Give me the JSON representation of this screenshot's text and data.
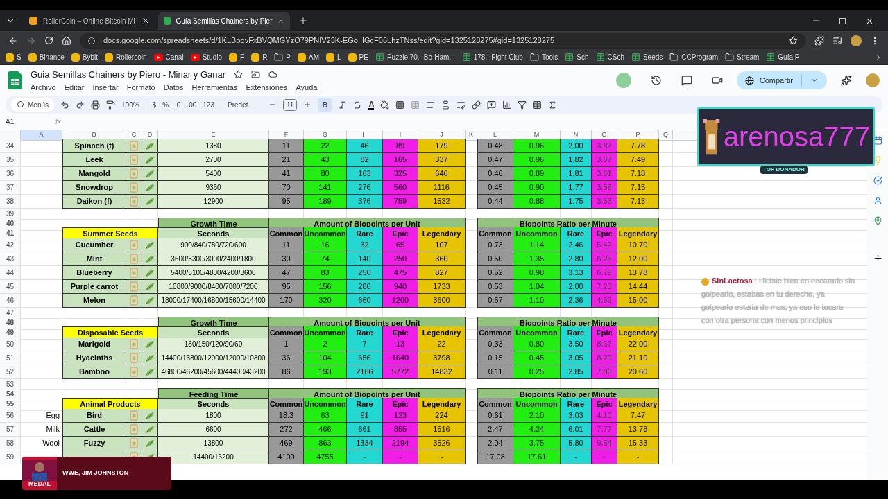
{
  "browser": {
    "tabs": [
      {
        "title": "RollerCoin – Online Bitcoin Mi",
        "selected": false
      },
      {
        "title": "Guía Semillas Chainers by Pier",
        "selected": true
      }
    ],
    "address": "docs.google.com/spreadsheets/d/1KLBogvFxBVQMGYzO79PNIV23K-EGo_IGcF06LhzTNss/edit?gid=1325128275#gid=1325128275",
    "bookmarks": [
      {
        "label": "S",
        "kind": "site"
      },
      {
        "label": "Binance",
        "kind": "site"
      },
      {
        "label": "Bybit",
        "kind": "site"
      },
      {
        "label": "Rollercoin",
        "kind": "site"
      },
      {
        "label": "Canal",
        "kind": "video"
      },
      {
        "label": "Studio",
        "kind": "video"
      },
      {
        "label": "F",
        "kind": "site"
      },
      {
        "label": "R",
        "kind": "site"
      },
      {
        "label": "P",
        "kind": "folder"
      },
      {
        "label": "AM",
        "kind": "site"
      },
      {
        "label": "L",
        "kind": "site"
      },
      {
        "label": "PE",
        "kind": "site"
      },
      {
        "label": "Puzzle 70.- Bo-Ham...",
        "kind": "sheet"
      },
      {
        "label": "178.- Fight Club",
        "kind": "sheet"
      },
      {
        "label": "Tools",
        "kind": "folder"
      },
      {
        "label": "Sch",
        "kind": "sheet"
      },
      {
        "label": "CSch",
        "kind": "sheet"
      },
      {
        "label": "Seeds",
        "kind": "sheet"
      },
      {
        "label": "CCProgram",
        "kind": "folder"
      },
      {
        "label": "Stream",
        "kind": "folder"
      },
      {
        "label": "Guía P",
        "kind": "sheet"
      }
    ]
  },
  "doc": {
    "title": "Guia Semillas Chainers by Piero - Minar y Ganar",
    "menus": [
      "Archivo",
      "Editar",
      "Insertar",
      "Formato",
      "Datos",
      "Herramientas",
      "Extensiones",
      "Ayuda"
    ],
    "share": "Compartir"
  },
  "toolbar": {
    "menus": "Menús",
    "zoom": "100%",
    "currency": "$",
    "percent": "%",
    "dec_less": ".0",
    "dec_more": ".00",
    "number_format": "123",
    "font": "Predet...",
    "font_size": "11",
    "bold_label": "B",
    "text_color_label": "A",
    "bold": true
  },
  "formula_bar": {
    "cell": "A1",
    "fx": "fx"
  },
  "columns": [
    "A",
    "B",
    "C",
    "D",
    "E",
    "F",
    "G",
    "H",
    "I",
    "J",
    "K",
    "L",
    "M",
    "N",
    "O",
    "P",
    "Q"
  ],
  "rows": [
    {
      "kind": "data",
      "number": "34",
      "name": "Spinach (f)",
      "seconds": "1380",
      "amounts": [
        "11",
        "22",
        "46",
        "89",
        "179"
      ],
      "ratios": [
        "0.48",
        "0.96",
        "2.00",
        "3.87",
        "7.78"
      ]
    },
    {
      "kind": "data",
      "number": "35",
      "name": "Leek",
      "seconds": "2700",
      "amounts": [
        "21",
        "43",
        "82",
        "165",
        "337"
      ],
      "ratios": [
        "0.47",
        "0.96",
        "1.82",
        "3.67",
        "7.49"
      ]
    },
    {
      "kind": "data",
      "number": "36",
      "name": "Mangold",
      "seconds": "5400",
      "amounts": [
        "41",
        "80",
        "163",
        "325",
        "646"
      ],
      "ratios": [
        "0.46",
        "0.89",
        "1.81",
        "3.61",
        "7.18"
      ]
    },
    {
      "kind": "data",
      "number": "37",
      "name": "Snowdrop",
      "seconds": "9360",
      "amounts": [
        "70",
        "141",
        "276",
        "560",
        "1116"
      ],
      "ratios": [
        "0.45",
        "0.90",
        "1.77",
        "3.59",
        "7.15"
      ]
    },
    {
      "kind": "data",
      "number": "38",
      "name": "Daikon (f)",
      "seconds": "12900",
      "amounts": [
        "95",
        "189",
        "376",
        "759",
        "1532"
      ],
      "ratios": [
        "0.44",
        "0.88",
        "1.75",
        "3.53",
        "7.13"
      ]
    },
    {
      "kind": "blank",
      "number": "39"
    },
    {
      "kind": "group_header",
      "number": "40",
      "groups": [
        "Growth Time",
        "Amount of Biopoints per Unit",
        "Biopoints Ratio per Minute"
      ]
    },
    {
      "kind": "column_header",
      "number": "41",
      "title": "Summer Seeds",
      "seconds": "Seconds",
      "amounts": [
        "Common",
        "Uncommon",
        "Rare",
        "Epic",
        "Legendary"
      ],
      "ratios": [
        "Common",
        "Uncommon",
        "Rare",
        "Epic",
        "Legendary"
      ]
    },
    {
      "kind": "data",
      "number": "42",
      "name": "Cucumber",
      "seconds": "900/840/780/720/600",
      "amounts": [
        "11",
        "16",
        "32",
        "65",
        "107"
      ],
      "ratios": [
        "0.73",
        "1.14",
        "2.46",
        "5.42",
        "10.70"
      ]
    },
    {
      "kind": "data",
      "number": "43",
      "name": "Mint",
      "seconds": "3600/3300/3000/2400/1800",
      "amounts": [
        "30",
        "74",
        "140",
        "250",
        "360"
      ],
      "ratios": [
        "0.50",
        "1.35",
        "2.80",
        "6.25",
        "12.00"
      ]
    },
    {
      "kind": "data",
      "number": "44",
      "name": "Blueberry",
      "seconds": "5400/5100/4800/4200/3600",
      "amounts": [
        "47",
        "83",
        "250",
        "475",
        "827"
      ],
      "ratios": [
        "0.52",
        "0.98",
        "3.13",
        "6.79",
        "13.78"
      ]
    },
    {
      "kind": "data",
      "number": "45",
      "name": "Purple carrot",
      "seconds": "10800/9000/8400/7800/7200",
      "amounts": [
        "95",
        "156",
        "280",
        "940",
        "1733"
      ],
      "ratios": [
        "0.53",
        "1.04",
        "2.00",
        "7.23",
        "14.44"
      ]
    },
    {
      "kind": "data",
      "number": "46",
      "name": "Melon",
      "seconds": "18000/17400/16800/15600/14400",
      "amounts": [
        "170",
        "320",
        "660",
        "1200",
        "3600"
      ],
      "ratios": [
        "0.57",
        "1.10",
        "2.36",
        "4.62",
        "15.00"
      ]
    },
    {
      "kind": "blank",
      "number": "47"
    },
    {
      "kind": "group_header",
      "number": "48",
      "groups": [
        "Growth Time",
        "Amount of Biopoints per Unit",
        "Biopoints Ratio per Minute"
      ]
    },
    {
      "kind": "column_header",
      "number": "49",
      "title": "Disposable Seeds",
      "seconds": "Seconds",
      "amounts": [
        "Common",
        "Uncommon",
        "Rare",
        "Epic",
        "Legendary"
      ],
      "ratios": [
        "Common",
        "Uncommon",
        "Rare",
        "Epic",
        "Legendary"
      ]
    },
    {
      "kind": "data",
      "number": "50",
      "name": "Marigold",
      "seconds": "180/150/120/90/60",
      "amounts": [
        "1",
        "2",
        "7",
        "13",
        "22"
      ],
      "ratios": [
        "0.33",
        "0.80",
        "3.50",
        "8.67",
        "22.00"
      ]
    },
    {
      "kind": "data",
      "number": "51",
      "name": "Hyacinths",
      "seconds": "14400/13800/12900/12000/10800",
      "amounts": [
        "36",
        "104",
        "656",
        "1640",
        "3798"
      ],
      "ratios": [
        "0.15",
        "0.45",
        "3.05",
        "8.20",
        "21.10"
      ]
    },
    {
      "kind": "data",
      "number": "52",
      "name": "Bamboo",
      "seconds": "46800/46200/45600/44400/43200",
      "amounts": [
        "86",
        "193",
        "2166",
        "5772",
        "14832"
      ],
      "ratios": [
        "0.11",
        "0.25",
        "2.85",
        "7.80",
        "20.60"
      ]
    },
    {
      "kind": "blank",
      "number": "53"
    },
    {
      "kind": "group_header",
      "number": "54",
      "groups": [
        "Feeding Time",
        "Amount of Biopoints per Unit",
        "Biopoints Ratio per Minute"
      ]
    },
    {
      "kind": "column_header",
      "number": "55",
      "title": "Animal Products",
      "seconds": "Seconds",
      "amounts": [
        "Common",
        "Uncommon",
        "Rare",
        "Epic",
        "Legendary"
      ],
      "ratios": [
        "Common",
        "Uncommon",
        "Rare",
        "Epic",
        "Legendary"
      ]
    },
    {
      "kind": "data",
      "number": "56",
      "label": "Egg",
      "name": "Bird",
      "seconds": "1800",
      "amounts": [
        "18.3",
        "63",
        "91",
        "123",
        "224"
      ],
      "ratios": [
        "0.61",
        "2.10",
        "3.03",
        "4.10",
        "7.47"
      ]
    },
    {
      "kind": "data",
      "number": "57",
      "label": "Milk",
      "name": "Cattle",
      "seconds": "6600",
      "amounts": [
        "272",
        "466",
        "661",
        "855",
        "1516"
      ],
      "ratios": [
        "2.47",
        "4.24",
        "6.01",
        "7.77",
        "13.78"
      ]
    },
    {
      "kind": "data",
      "number": "58",
      "label": "Wool",
      "name": "Fuzzy",
      "seconds": "13800",
      "amounts": [
        "469",
        "863",
        "1334",
        "2194",
        "3526"
      ],
      "ratios": [
        "2.04",
        "3.75",
        "5.80",
        "9.54",
        "15.33"
      ]
    },
    {
      "kind": "data",
      "number": "59",
      "seconds": "14400/16200",
      "amounts": [
        "4100",
        "4755",
        "-",
        "-",
        "-"
      ],
      "ratios": [
        "17.08",
        "17.61",
        "-",
        "-",
        "-"
      ]
    }
  ],
  "donor": {
    "name": "arenosa777",
    "tag": "TOP DONADOR"
  },
  "chat": {
    "user": "SinLactosa",
    "separator": ":",
    "message": "Hiciste bien en encararlo sin golpearlo, estabas en tu derecho, ya golpearlo estaria de mas, ya eso le tocara con otra persona con menos principios"
  },
  "now_playing": {
    "logo": "MEDAL",
    "title": "WWE, JIM JOHNSTON"
  }
}
